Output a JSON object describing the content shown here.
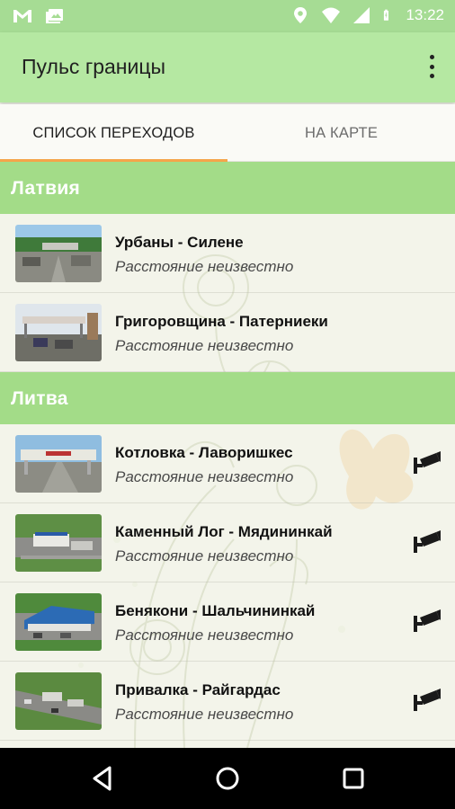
{
  "status_bar": {
    "time": "13:22",
    "icons": [
      "gmail-icon",
      "photo-icon",
      "location-icon",
      "wifi-icon",
      "signal-icon",
      "battery-icon"
    ]
  },
  "app_bar": {
    "title": "Пульс границы",
    "menu_icon": "overflow-menu-icon"
  },
  "tabs": [
    {
      "label": "СПИСОК ПЕРЕХОДОВ",
      "active": true
    },
    {
      "label": "НА КАРТЕ",
      "active": false
    }
  ],
  "colors": {
    "status_bar": "#a6dc94",
    "app_bar": "#b5e8a2",
    "section_header": "#a3dc88",
    "tab_indicator": "#f5a54a"
  },
  "sections": [
    {
      "name": "Латвия",
      "items": [
        {
          "title": "Урбаны - Силене",
          "subtitle": "Расстояние неизвестно",
          "camera": false
        },
        {
          "title": "Григоровщина - Патерниеки",
          "subtitle": "Расстояние неизвестно",
          "camera": false
        }
      ]
    },
    {
      "name": "Литва",
      "items": [
        {
          "title": "Котловка - Лаворишкес",
          "subtitle": "Расстояние неизвестно",
          "camera": true
        },
        {
          "title": "Каменный Лог - Мядининкай",
          "subtitle": "Расстояние неизвестно",
          "camera": true
        },
        {
          "title": "Бенякони - Шальчининкай",
          "subtitle": "Расстояние неизвестно",
          "camera": true
        },
        {
          "title": "Привалка - Райгардас",
          "subtitle": "Расстояние неизвестно",
          "camera": true
        }
      ]
    }
  ],
  "nav_bar": {
    "buttons": [
      "back-icon",
      "home-icon",
      "recents-icon"
    ]
  }
}
